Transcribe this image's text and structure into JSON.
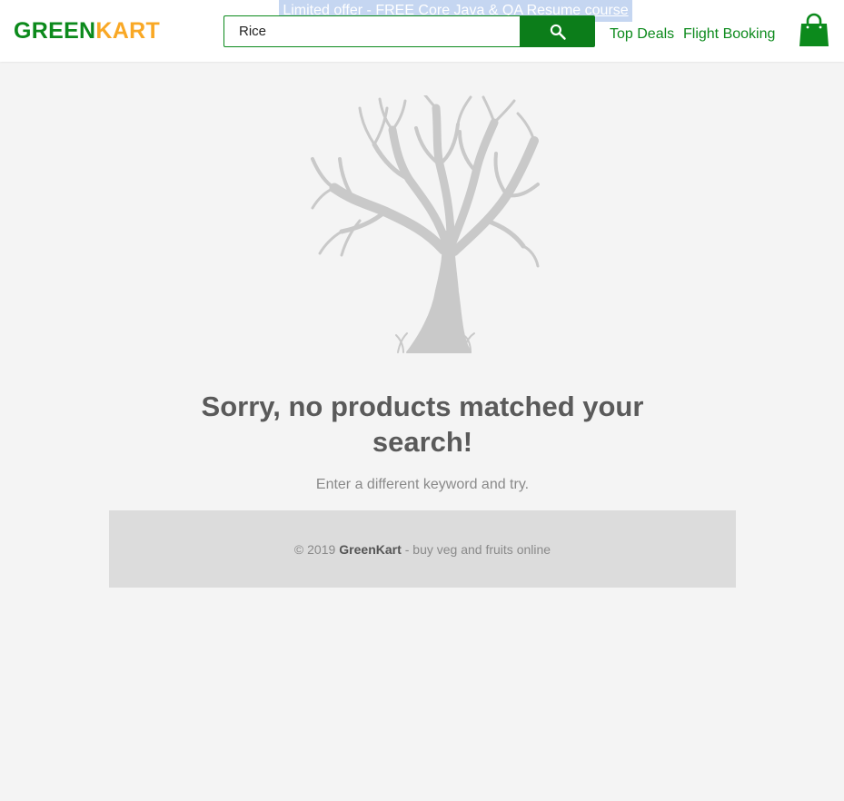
{
  "header": {
    "logo_part1": "GREEN",
    "logo_part2": "KART",
    "offer_text": "Limited offer - FREE Core Java & QA Resume course",
    "search": {
      "value": "Rice"
    },
    "nav": {
      "top_deals": "Top Deals",
      "flight_booking": "Flight Booking"
    },
    "icons": {
      "search": "search-icon",
      "cart": "shopping-bag-icon"
    }
  },
  "empty_state": {
    "illustration": "bare-tree-illustration",
    "title": "Sorry, no products matched your search!",
    "subtitle": "Enter a different keyword and try."
  },
  "footer": {
    "copyright": "© 2019",
    "brand": "GreenKart",
    "tagline": "- buy veg and fruits online"
  },
  "colors": {
    "brand_green": "#0c8a1c",
    "brand_orange": "#f9a825",
    "search_button": "#0c7d1a",
    "page_bg": "#f4f4f4",
    "footer_bg": "#dcdcdc",
    "offer_bg": "#c5d6f1"
  }
}
